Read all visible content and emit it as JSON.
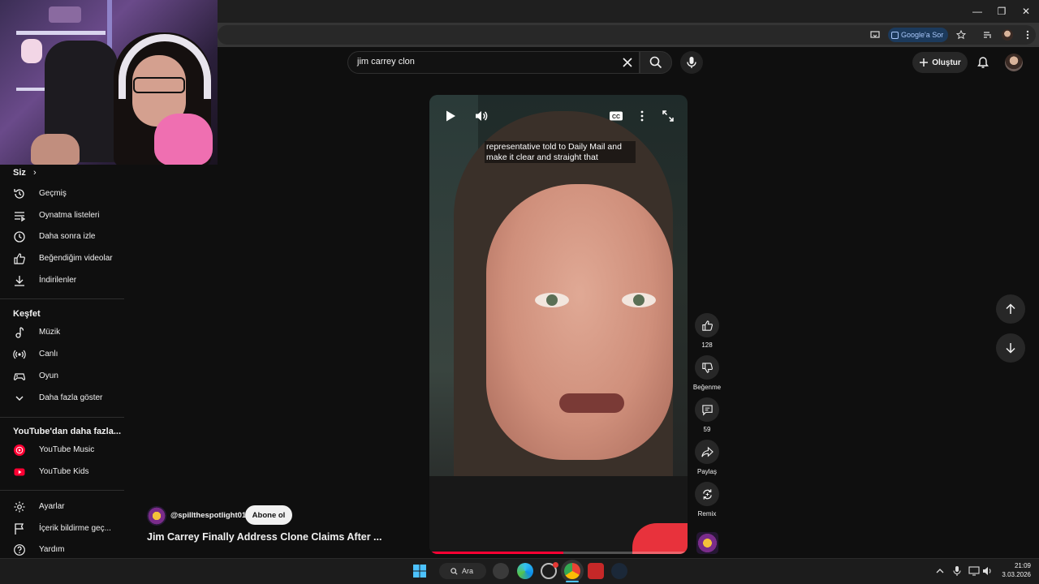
{
  "browser": {
    "ask_google_label": "Google'a Sor"
  },
  "header": {
    "search_query": "jim carrey clon",
    "create_label": "Oluştur"
  },
  "sidebar": {
    "you_heading": "Siz",
    "you_items": [
      {
        "label": "Geçmiş",
        "icon": "history-icon"
      },
      {
        "label": "Oynatma listeleri",
        "icon": "playlist-icon"
      },
      {
        "label": "Daha sonra izle",
        "icon": "clock-icon"
      },
      {
        "label": "Beğendiğim videolar",
        "icon": "thumbs-up-icon"
      },
      {
        "label": "İndirilenler",
        "icon": "download-icon"
      }
    ],
    "explore_heading": "Keşfet",
    "explore_items": [
      {
        "label": "Müzik",
        "icon": "music-note-icon"
      },
      {
        "label": "Canlı",
        "icon": "live-icon"
      },
      {
        "label": "Oyun",
        "icon": "gamepad-icon"
      },
      {
        "label": "Daha fazla göster",
        "icon": "chevron-down-icon"
      }
    ],
    "more_heading": "YouTube'dan daha fazla...",
    "more_items": [
      {
        "label": "YouTube Music",
        "icon": "youtube-music-icon"
      },
      {
        "label": "YouTube Kids",
        "icon": "youtube-kids-icon"
      }
    ],
    "footer_items": [
      {
        "label": "Ayarlar",
        "icon": "gear-icon"
      },
      {
        "label": "İçerik bildirme geç...",
        "icon": "flag-icon"
      },
      {
        "label": "Yardım",
        "icon": "help-icon"
      }
    ]
  },
  "short": {
    "caption": "representative told to Daily Mail and make it clear and straight that",
    "progress": 0.52,
    "channel_handle": "@spillthespotlight01",
    "subscribe_label": "Abone ol",
    "title": "Jim Carrey Finally Address Clone Claims After ..."
  },
  "actions": {
    "like_count": "128",
    "dislike_label": "Beğenme",
    "comment_count": "59",
    "share_label": "Paylaş",
    "remix_label": "Remix"
  },
  "taskbar": {
    "search_label": "Ara",
    "time": "21:09",
    "date": "3.03.2026"
  },
  "colors": {
    "background": "#0f0f0f",
    "accent_red": "#ff0033",
    "chip": "#272727"
  }
}
